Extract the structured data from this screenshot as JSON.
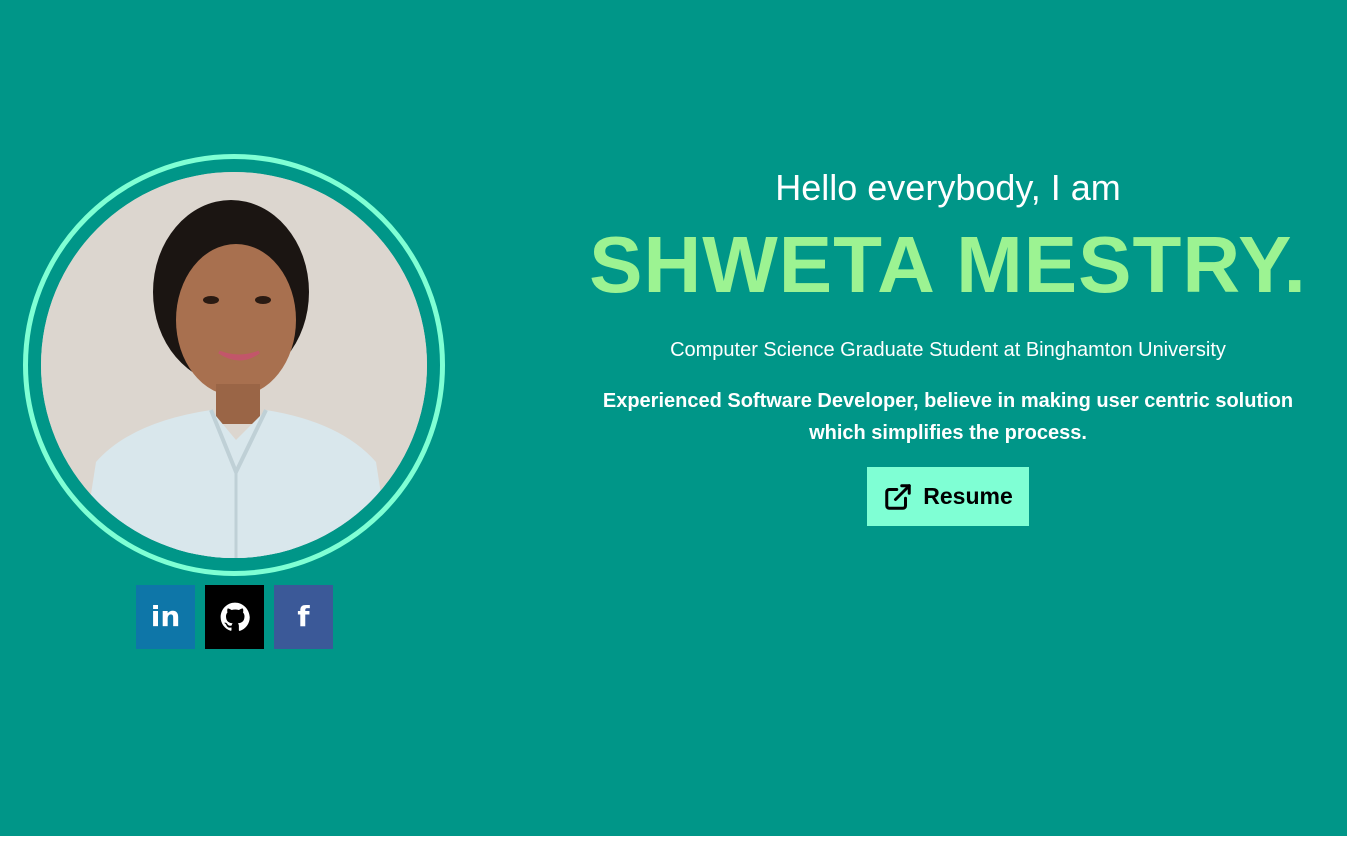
{
  "hero": {
    "greeting": "Hello everybody, I am",
    "name": "SHWETA MESTRY.",
    "tagline": "Computer Science Graduate Student at Binghamton University",
    "summary": "Experienced Software Developer, believe in making user centric solution which simplifies the process.",
    "resume_label": "Resume"
  },
  "social": [
    {
      "name": "linkedin",
      "glyph": "in",
      "icon": "linkedin-icon",
      "color": "#0e76a8"
    },
    {
      "name": "github",
      "glyph": "",
      "icon": "github-icon",
      "color": "#000000"
    },
    {
      "name": "facebook",
      "glyph": "f",
      "icon": "facebook-icon",
      "color": "#3b5998"
    }
  ],
  "colors": {
    "background": "#009688",
    "accent": "#7fffd4",
    "name": "#9cf392",
    "text": "#ffffff"
  },
  "icons": {
    "resume": "external-link-icon",
    "photo": "profile-photo"
  }
}
